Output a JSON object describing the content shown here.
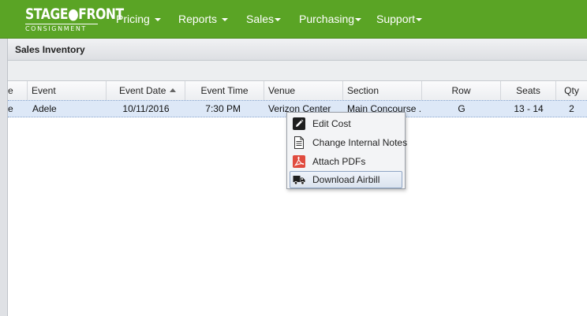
{
  "brand": {
    "logo_top": "STAGE●FRONT",
    "logo_bottom": "CONSIGNMENT",
    "accent_color": "#5aa425"
  },
  "nav": {
    "items": [
      {
        "label": "Pricing",
        "icon": "caret-down-icon"
      },
      {
        "label": "Reports",
        "icon": "caret-down-icon"
      },
      {
        "label": "Sales",
        "icon": "caret-down-icon"
      },
      {
        "label": "Purchasing",
        "icon": "caret-down-icon"
      },
      {
        "label": "Support",
        "icon": "caret-down-icon"
      }
    ]
  },
  "panel": {
    "title": "Sales Inventory"
  },
  "grid": {
    "columns": [
      "e",
      "Event",
      "Event Date",
      "Event Time",
      "Venue",
      "Section",
      "Row",
      "Seats",
      "Qty"
    ],
    "sort": {
      "column": "Event Date",
      "direction": "ascending"
    },
    "rows": [
      {
        "col0": "e",
        "event": "Adele",
        "event_date": "10/11/2016",
        "event_time": "7:30 PM",
        "venue": "Verizon Center",
        "section": "Main Concourse ...",
        "row": "G",
        "seats": "13 - 14",
        "qty": "2"
      }
    ]
  },
  "context_menu": {
    "items": [
      {
        "label": "Edit Cost",
        "icon": "pencil-icon"
      },
      {
        "label": "Change Internal Notes",
        "icon": "document-icon"
      },
      {
        "label": "Attach PDFs",
        "icon": "pdf-icon"
      },
      {
        "label": "Download Airbill",
        "icon": "truck-icon",
        "highlighted": true
      }
    ]
  }
}
